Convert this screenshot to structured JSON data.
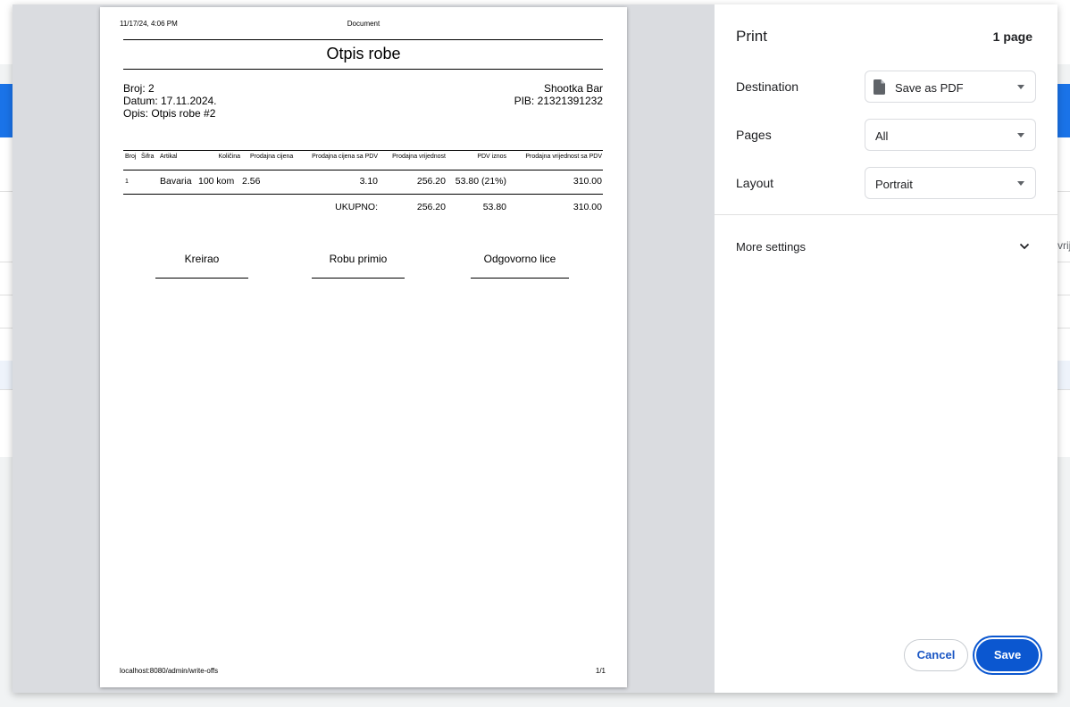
{
  "background": {
    "edge_text": "vrij"
  },
  "preview": {
    "header_datetime": "11/17/24, 4:06 PM",
    "header_title": "Document",
    "doc_title": "Otpis robe",
    "info_left": {
      "number": "Broj: 2",
      "date": "Datum: 17.11.2024.",
      "description": "Opis: Otpis robe #2"
    },
    "info_right": {
      "company": "Shootka Bar",
      "pib": "PIB: 21321391232"
    },
    "table": {
      "headers": {
        "broj": "Broj",
        "sifra": "Šifra",
        "artikal": "Artikal",
        "kolicina": "Količina",
        "prodajna_cijena": "Prodajna cijena",
        "prodajna_cijena_pdv": "Prodajna cijena sa PDV",
        "prodajna_vrijednost": "Prodajna vrijednost",
        "pdv_iznos": "PDV iznos",
        "prodajna_vrijednost_pdv": "Prodajna vrijednost sa PDV"
      },
      "row": {
        "broj": "1",
        "artikal": "Bavaria",
        "kolicina": "100 kom",
        "prodajna_cijena": "2.56",
        "prodajna_cijena_pdv": "3.10",
        "prodajna_vrijednost": "256.20",
        "pdv_iznos": "53.80 (21%)",
        "prodajna_vrijednost_pdv": "310.00"
      },
      "total": {
        "label": "UKUPNO:",
        "prodajna_vrijednost": "256.20",
        "pdv_iznos": "53.80",
        "prodajna_vrijednost_pdv": "310.00"
      }
    },
    "signatures": {
      "created": "Kreirao",
      "received": "Robu primio",
      "responsible": "Odgovorno lice"
    },
    "footer_url": "localhost:8080/admin/write-offs",
    "footer_page": "1/1"
  },
  "panel": {
    "title": "Print",
    "page_count": "1 page",
    "destination_label": "Destination",
    "destination_value": "Save as PDF",
    "pages_label": "Pages",
    "pages_value": "All",
    "layout_label": "Layout",
    "layout_value": "Portrait",
    "more_settings": "More settings",
    "cancel_label": "Cancel",
    "save_label": "Save"
  },
  "icons": {
    "destination": "document-icon",
    "more_settings": "chevron-down-icon"
  },
  "colors": {
    "accent": "#0b57d0",
    "app_header": "#1a73e8",
    "preview_bg": "#dadce0"
  }
}
